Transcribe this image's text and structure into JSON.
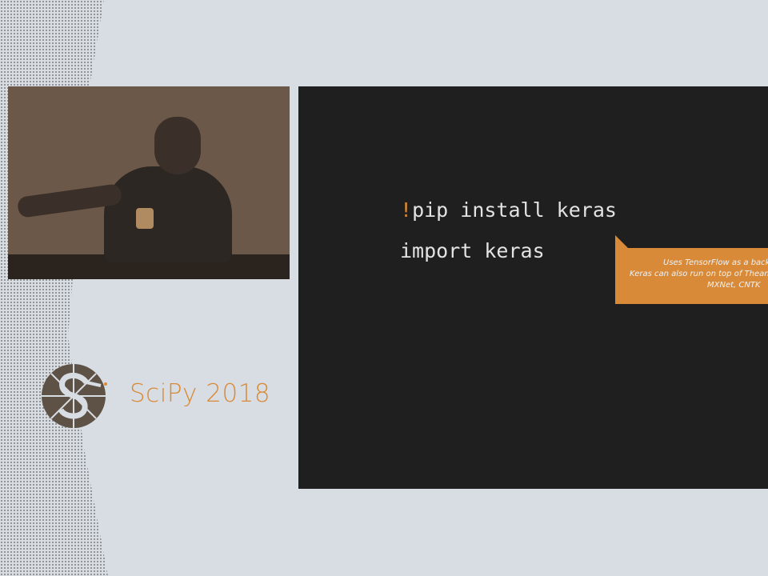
{
  "slide": {
    "code_lines": [
      {
        "prefix": "!",
        "text": "pip install keras"
      },
      {
        "prefix": "",
        "text": "import keras"
      }
    ],
    "callout": [
      "Uses TensorFlow as a backend",
      "Keras can also run on top of Theano,",
      "MXNet, CNTK"
    ]
  },
  "brand": {
    "name": "SciPy 2018"
  },
  "colors": {
    "accent": "#d98a38",
    "slide_bg": "#1f1f1f",
    "page_bg": "#d8dde3"
  }
}
